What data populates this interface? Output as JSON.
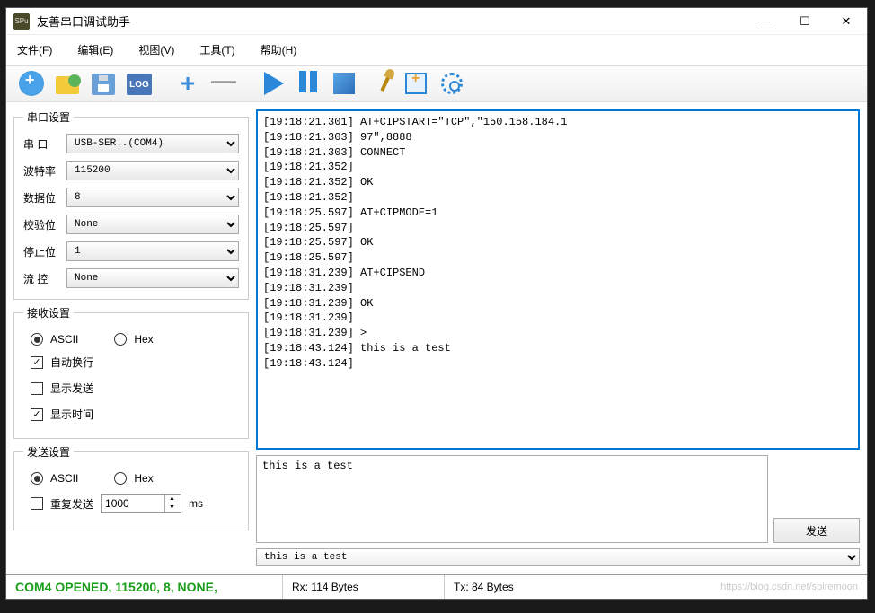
{
  "window": {
    "app_icon_text": "SPu",
    "title": "友善串口调试助手"
  },
  "menu": {
    "file": "文件(F)",
    "edit": "编辑(E)",
    "view": "视图(V)",
    "tools": "工具(T)",
    "help": "帮助(H)"
  },
  "toolbar": {
    "log_text": "LOG"
  },
  "serial": {
    "legend": "串口设置",
    "port_label": "串  口",
    "port_value": "USB-SER..(COM4)",
    "baud_label": "波特率",
    "baud_value": "115200",
    "data_label": "数据位",
    "data_value": "8",
    "parity_label": "校验位",
    "parity_value": "None",
    "stop_label": "停止位",
    "stop_value": "1",
    "flow_label": "流  控",
    "flow_value": "None"
  },
  "recv": {
    "legend": "接收设置",
    "ascii": "ASCII",
    "hex": "Hex",
    "autowrap": "自动换行",
    "showsend": "显示发送",
    "showtime": "显示时间"
  },
  "send": {
    "legend": "发送设置",
    "ascii": "ASCII",
    "hex": "Hex",
    "repeat": "重复发送",
    "interval": "1000",
    "unit": "ms"
  },
  "rx_lines": [
    "[19:18:21.301] AT+CIPSTART=\"TCP\",\"150.158.184.1",
    "[19:18:21.303] 97\",8888",
    "[19:18:21.303] CONNECT",
    "[19:18:21.352] ",
    "[19:18:21.352] OK",
    "[19:18:21.352] ",
    "[19:18:25.597] AT+CIPMODE=1",
    "[19:18:25.597] ",
    "[19:18:25.597] OK",
    "[19:18:25.597] ",
    "[19:18:31.239] AT+CIPSEND",
    "[19:18:31.239] ",
    "[19:18:31.239] OK",
    "[19:18:31.239] ",
    "[19:18:31.239] >",
    "[19:18:43.124] this is a test",
    "[19:18:43.124] "
  ],
  "tx": {
    "value": "this is a test",
    "send_label": "发送",
    "history": "this is a test"
  },
  "status": {
    "connection": "COM4 OPENED, 115200, 8, NONE,",
    "rx": "Rx: 114 Bytes",
    "tx": "Tx: 84 Bytes",
    "watermark": "https://blog.csdn.net/spiremoon"
  }
}
